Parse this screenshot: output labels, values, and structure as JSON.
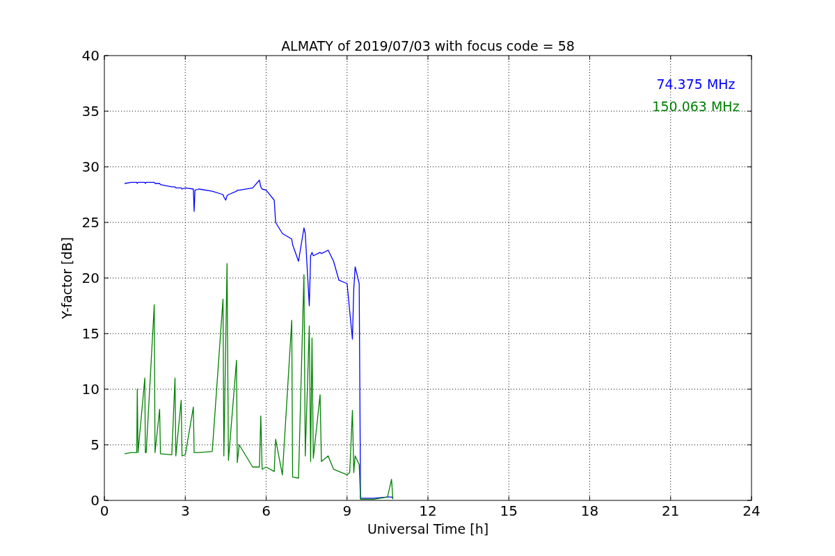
{
  "chart_data": {
    "type": "line",
    "title": "ALMATY of 2019/07/03 with focus code = 58",
    "xlabel": "Universal Time [h]",
    "ylabel": "Y-factor [dB]",
    "x": [
      0.75,
      1.0,
      1.2,
      1.22,
      1.25,
      1.5,
      1.52,
      1.55,
      1.85,
      1.88,
      2.05,
      2.08,
      2.5,
      2.62,
      2.65,
      2.85,
      2.88,
      3.0,
      3.3,
      3.33,
      3.36,
      3.5,
      4.0,
      4.4,
      4.43,
      4.5,
      4.55,
      4.6,
      4.9,
      4.93,
      5.0,
      5.5,
      5.75,
      5.8,
      5.85,
      6.0,
      6.3,
      6.35,
      6.6,
      6.95,
      6.98,
      7.2,
      7.4,
      7.45,
      7.6,
      7.65,
      7.7,
      7.75,
      8.0,
      8.05,
      8.3,
      8.5,
      8.7,
      9.0,
      9.1,
      9.2,
      9.25,
      9.3,
      9.45,
      9.5,
      10.0,
      10.5,
      10.65,
      10.7
    ],
    "series": [
      {
        "name": "74.375 MHz",
        "color": "#0000ff",
        "values": [
          28.5,
          28.6,
          28.6,
          28.5,
          28.6,
          28.6,
          28.5,
          28.6,
          28.6,
          28.5,
          28.5,
          28.4,
          28.2,
          28.2,
          28.1,
          28.1,
          28.0,
          28.1,
          28.0,
          26.0,
          27.9,
          28.0,
          27.8,
          27.5,
          27.3,
          27.0,
          27.4,
          27.5,
          27.8,
          27.9,
          27.9,
          28.1,
          28.8,
          28.2,
          28.0,
          27.9,
          27.0,
          25.0,
          24.0,
          23.5,
          23.0,
          21.5,
          24.5,
          24.0,
          17.5,
          22.0,
          22.3,
          22.0,
          22.3,
          22.2,
          22.5,
          21.5,
          19.8,
          19.5,
          17.0,
          14.5,
          19.0,
          21.0,
          19.5,
          0.2,
          0.2,
          0.3,
          0.3,
          0.2
        ]
      },
      {
        "name": "150.063 MHz",
        "color": "#008000",
        "values": [
          4.2,
          4.3,
          4.3,
          10.0,
          4.3,
          11.0,
          4.3,
          4.3,
          17.6,
          4.3,
          8.2,
          4.2,
          4.1,
          11.0,
          4.0,
          9.0,
          4.0,
          4.1,
          8.4,
          4.3,
          4.3,
          4.3,
          4.4,
          18.1,
          4.0,
          14.2,
          21.3,
          3.6,
          12.6,
          3.4,
          5.0,
          3.0,
          3.0,
          7.6,
          2.8,
          3.0,
          2.6,
          5.5,
          2.3,
          16.2,
          2.1,
          2.0,
          20.3,
          4.0,
          15.7,
          3.5,
          14.6,
          3.8,
          9.5,
          3.5,
          4.0,
          2.8,
          2.6,
          2.3,
          2.5,
          8.1,
          2.5,
          4.0,
          3.2,
          0.1,
          0.1,
          0.3,
          1.9,
          0.1
        ]
      }
    ],
    "xlim": [
      0,
      24
    ],
    "ylim": [
      0,
      40
    ],
    "grid": true,
    "xticks": [
      0,
      3,
      6,
      9,
      12,
      15,
      18,
      21,
      24
    ],
    "yticks": [
      0,
      5,
      10,
      15,
      20,
      25,
      30,
      35,
      40
    ]
  }
}
